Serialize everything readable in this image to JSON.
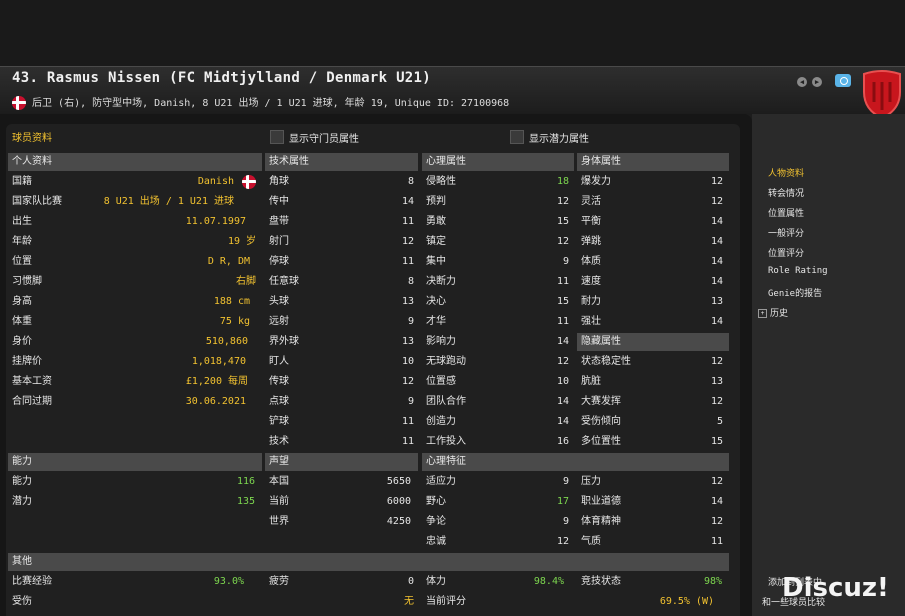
{
  "header": {
    "title": "43. Rasmus Nissen (FC Midtjylland / Denmark U21)",
    "subtitle": "后卫 (右), 防守型中场, Danish, 8 U21 出场 / 1 U21 进球, 年龄 19, Unique ID: 27100968"
  },
  "toolbar": {
    "tab_title": "球员资料",
    "show_gk_attrs": "显示守门员属性",
    "show_potential_attrs": "显示潜力属性"
  },
  "personal": {
    "title": "个人资料",
    "rows": [
      {
        "label": "国籍",
        "value": "Danish"
      },
      {
        "label": "国家队比赛",
        "value": "8 U21 出场 / 1 U21 进球"
      },
      {
        "label": "出生",
        "value": "11.07.1997"
      },
      {
        "label": "年龄",
        "value": "19 岁"
      },
      {
        "label": "位置",
        "value": "D R, DM"
      },
      {
        "label": "习惯脚",
        "value": "右脚"
      },
      {
        "label": "身高",
        "value": "188 cm"
      },
      {
        "label": "体重",
        "value": "75 kg"
      },
      {
        "label": "身价",
        "value": "510,860"
      },
      {
        "label": "挂牌价",
        "value": "1,018,470"
      },
      {
        "label": "基本工资",
        "value": "£1,200 每周"
      },
      {
        "label": "合同过期",
        "value": "30.06.2021"
      }
    ]
  },
  "technical": {
    "title": "技术属性",
    "rows": [
      {
        "label": "角球",
        "value": "8"
      },
      {
        "label": "传中",
        "value": "14"
      },
      {
        "label": "盘带",
        "value": "11"
      },
      {
        "label": "射门",
        "value": "12"
      },
      {
        "label": "停球",
        "value": "11"
      },
      {
        "label": "任意球",
        "value": "8"
      },
      {
        "label": "头球",
        "value": "13"
      },
      {
        "label": "远射",
        "value": "9"
      },
      {
        "label": "界外球",
        "value": "13"
      },
      {
        "label": "盯人",
        "value": "10"
      },
      {
        "label": "传球",
        "value": "12"
      },
      {
        "label": "点球",
        "value": "9"
      },
      {
        "label": "铲球",
        "value": "11"
      },
      {
        "label": "技术",
        "value": "11"
      }
    ]
  },
  "mental": {
    "title": "心理属性",
    "rows": [
      {
        "label": "侵略性",
        "value": "18"
      },
      {
        "label": "预判",
        "value": "12"
      },
      {
        "label": "勇敢",
        "value": "15"
      },
      {
        "label": "镇定",
        "value": "12"
      },
      {
        "label": "集中",
        "value": "9"
      },
      {
        "label": "决断力",
        "value": "11"
      },
      {
        "label": "决心",
        "value": "15"
      },
      {
        "label": "才华",
        "value": "11"
      },
      {
        "label": "影响力",
        "value": "14"
      },
      {
        "label": "无球跑动",
        "value": "12"
      },
      {
        "label": "位置感",
        "value": "10"
      },
      {
        "label": "团队合作",
        "value": "14"
      },
      {
        "label": "创造力",
        "value": "14"
      },
      {
        "label": "工作投入",
        "value": "16"
      }
    ]
  },
  "physical": {
    "title": "身体属性",
    "rows": [
      {
        "label": "爆发力",
        "value": "12"
      },
      {
        "label": "灵活",
        "value": "12"
      },
      {
        "label": "平衡",
        "value": "14"
      },
      {
        "label": "弹跳",
        "value": "14"
      },
      {
        "label": "体质",
        "value": "14"
      },
      {
        "label": "速度",
        "value": "14"
      },
      {
        "label": "耐力",
        "value": "13"
      },
      {
        "label": "强壮",
        "value": "14"
      }
    ]
  },
  "hidden": {
    "title": "隐藏属性",
    "rows": [
      {
        "label": "状态稳定性",
        "value": "12"
      },
      {
        "label": "肮脏",
        "value": "13"
      },
      {
        "label": "大赛发挥",
        "value": "12"
      },
      {
        "label": "受伤倾向",
        "value": "5"
      },
      {
        "label": "多位置性",
        "value": "15"
      }
    ]
  },
  "ability": {
    "title": "能力",
    "rows": [
      {
        "label": "能力",
        "value": "116"
      },
      {
        "label": "潜力",
        "value": "135"
      }
    ]
  },
  "reputation": {
    "title": "声望",
    "rows": [
      {
        "label": "本国",
        "value": "5650"
      },
      {
        "label": "当前",
        "value": "6000"
      },
      {
        "label": "世界",
        "value": "4250"
      }
    ]
  },
  "traits": {
    "title": "心理特征",
    "left": [
      {
        "label": "适应力",
        "value": "9"
      },
      {
        "label": "野心",
        "value": "17"
      },
      {
        "label": "争论",
        "value": "9"
      },
      {
        "label": "忠诚",
        "value": "12"
      }
    ],
    "right": [
      {
        "label": "压力",
        "value": "12"
      },
      {
        "label": "职业道德",
        "value": "14"
      },
      {
        "label": "体育精神",
        "value": "12"
      },
      {
        "label": "气质",
        "value": "11"
      }
    ]
  },
  "other": {
    "title": "其他",
    "row1": [
      {
        "label": "比赛经验",
        "value": "93.0%"
      },
      {
        "label": "疲劳",
        "value": "0"
      },
      {
        "label": "体力",
        "value": "98.4%"
      },
      {
        "label": "竞技状态",
        "value": "98%"
      }
    ],
    "row2": [
      {
        "label": "受伤",
        "value": ""
      },
      {
        "label": "",
        "value": "无"
      },
      {
        "label": "当前评分",
        "value": "69.5% (W)"
      }
    ]
  },
  "sidebar": {
    "items": [
      {
        "label": "人物资料"
      },
      {
        "label": "转会情况"
      },
      {
        "label": "位置属性"
      },
      {
        "label": "一般评分"
      },
      {
        "label": "位置评分"
      },
      {
        "label": "Role Rating"
      },
      {
        "label": "Genie的报告"
      },
      {
        "label": "历史"
      }
    ],
    "bottom1": "添加到列表中",
    "bottom2": "和一些球员比较"
  },
  "watermark": "Discuz!",
  "colors": {
    "accent": "#f2c230",
    "high": "#7dd64f",
    "section_bg": "#4a4a4a"
  }
}
